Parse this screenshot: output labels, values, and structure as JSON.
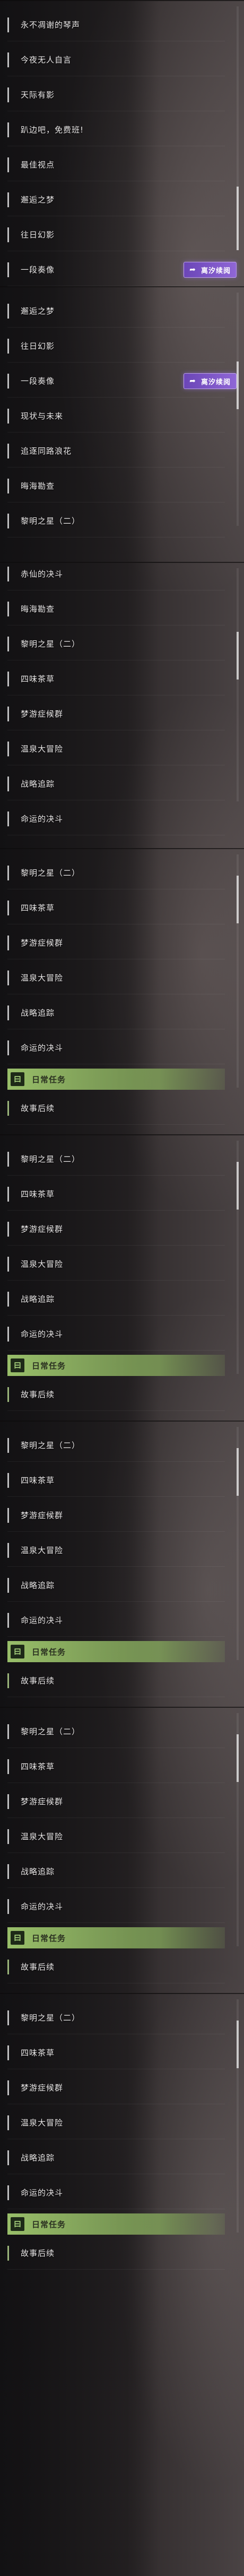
{
  "app": {
    "badge_label": "离汐续阅",
    "badge_icon": "share-arrow-icon",
    "section_icon": "calendar-icon",
    "section_icon_glyph": "曰"
  },
  "panels": [
    {
      "items": [
        {
          "label": "永不凋谢的琴声"
        },
        {
          "label": "今夜无人自言"
        },
        {
          "label": "天际有影"
        },
        {
          "label": "趴边吧，免费班!"
        },
        {
          "label": "最佳视点"
        },
        {
          "label": "邂逅之梦"
        },
        {
          "label": "往日幻影"
        },
        {
          "label": "一段奏像"
        }
      ]
    },
    {
      "items": [
        {
          "label": "邂逅之梦"
        },
        {
          "label": "往日幻影"
        },
        {
          "label": "一段奏像"
        },
        {
          "label": "现状与未来"
        },
        {
          "label": "追逐同路浪花"
        },
        {
          "label": "晦海勘查"
        },
        {
          "label": "黎明之星（二）"
        }
      ]
    },
    {
      "items": [
        {
          "label": "赤仙的决斗"
        },
        {
          "label": "晦海勘查"
        },
        {
          "label": "黎明之星（二）"
        },
        {
          "label": "四味茶草"
        },
        {
          "label": "梦游症候群"
        },
        {
          "label": "温泉大冒险"
        },
        {
          "label": "战略追踪"
        },
        {
          "label": "命运的决斗"
        }
      ]
    },
    {
      "items": [
        {
          "label": "黎明之星（二）"
        },
        {
          "label": "四味茶草"
        },
        {
          "label": "梦游症候群"
        },
        {
          "label": "温泉大冒险"
        },
        {
          "label": "战略追踪"
        },
        {
          "label": "命运的决斗"
        }
      ],
      "section": {
        "label": "日常任务"
      },
      "after": {
        "label": "故事后续"
      }
    },
    {
      "items": [
        {
          "label": "黎明之星（二）"
        },
        {
          "label": "四味茶草"
        },
        {
          "label": "梦游症候群"
        },
        {
          "label": "温泉大冒险"
        },
        {
          "label": "战略追踪"
        },
        {
          "label": "命运的决斗"
        }
      ],
      "section": {
        "label": "日常任务"
      },
      "after": {
        "label": "故事后续"
      }
    },
    {
      "items": [
        {
          "label": "黎明之星（二）"
        },
        {
          "label": "四味茶草"
        },
        {
          "label": "梦游症候群"
        },
        {
          "label": "温泉大冒险"
        },
        {
          "label": "战略追踪"
        },
        {
          "label": "命运的决斗"
        }
      ],
      "section": {
        "label": "日常任务"
      },
      "after": {
        "label": "故事后续"
      }
    },
    {
      "items": [
        {
          "label": "黎明之星（二）"
        },
        {
          "label": "四味茶草"
        },
        {
          "label": "梦游症候群"
        },
        {
          "label": "温泉大冒险"
        },
        {
          "label": "战略追踪"
        },
        {
          "label": "命运的决斗"
        }
      ],
      "section": {
        "label": "日常任务"
      },
      "after": {
        "label": "故事后续"
      }
    },
    {
      "items": [
        {
          "label": "黎明之星（二）"
        },
        {
          "label": "四味茶草"
        },
        {
          "label": "梦游症候群"
        },
        {
          "label": "温泉大冒险"
        },
        {
          "label": "战略追踪"
        },
        {
          "label": "命运的决斗"
        }
      ],
      "section": {
        "label": "日常任务"
      },
      "after": {
        "label": "故事后续"
      }
    }
  ]
}
